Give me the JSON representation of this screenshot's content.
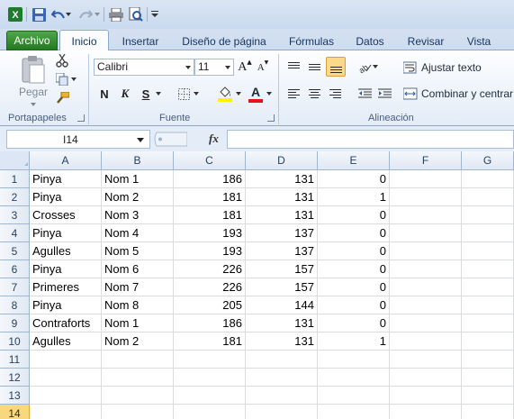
{
  "title_bar": {
    "excel_icon": "excel-x-icon",
    "save_icon": "save-icon",
    "undo_icon": "undo-icon",
    "redo_icon": "redo-icon",
    "print_icon": "print-icon",
    "preview_icon": "print-preview-icon"
  },
  "ribbon_tabs": [
    "Archivo",
    "Inicio",
    "Insertar",
    "Diseño de página",
    "Fórmulas",
    "Datos",
    "Revisar",
    "Vista"
  ],
  "ribbon": {
    "clipboard": {
      "paste_label": "Pegar",
      "group_label": "Portapapeles"
    },
    "font": {
      "font_name": "Calibri",
      "font_size": "11",
      "bold": "N",
      "italic": "K",
      "underline": "S",
      "grow": "A",
      "shrink": "A",
      "font_color": "A",
      "group_label": "Fuente"
    },
    "alignment": {
      "wrap_text": "Ajustar texto",
      "merge_center": "Combinar y centrar",
      "group_label": "Alineación"
    }
  },
  "formula_bar": {
    "name_box": "I14",
    "fx_label": "fx",
    "formula": ""
  },
  "sheet": {
    "columns": [
      "A",
      "B",
      "C",
      "D",
      "E",
      "F",
      "G"
    ],
    "rows": [
      [
        "Pinya",
        "Nom 1",
        "186",
        "131",
        "0",
        "",
        ""
      ],
      [
        "Pinya",
        "Nom 2",
        "181",
        "131",
        "1",
        "",
        ""
      ],
      [
        "Crosses",
        "Nom 3",
        "181",
        "131",
        "0",
        "",
        ""
      ],
      [
        "Pinya",
        "Nom 4",
        "193",
        "137",
        "0",
        "",
        ""
      ],
      [
        "Agulles",
        "Nom 5",
        "193",
        "137",
        "0",
        "",
        ""
      ],
      [
        "Pinya",
        "Nom 6",
        "226",
        "157",
        "0",
        "",
        ""
      ],
      [
        "Primeres",
        "Nom 7",
        "226",
        "157",
        "0",
        "",
        ""
      ],
      [
        "Pinya",
        "Nom 8",
        "205",
        "144",
        "0",
        "",
        ""
      ],
      [
        "Contraforts",
        "Nom 1",
        "186",
        "131",
        "0",
        "",
        ""
      ],
      [
        "Agulles",
        "Nom 2",
        "181",
        "131",
        "1",
        "",
        ""
      ],
      [
        "",
        "",
        "",
        "",
        "",
        "",
        ""
      ],
      [
        "",
        "",
        "",
        "",
        "",
        "",
        ""
      ],
      [
        "",
        "",
        "",
        "",
        "",
        "",
        ""
      ],
      [
        "",
        "",
        "",
        "",
        "",
        "",
        ""
      ]
    ],
    "row_numbers": [
      "1",
      "2",
      "3",
      "4",
      "5",
      "6",
      "7",
      "8",
      "9",
      "10",
      "11",
      "12",
      "13",
      "14"
    ],
    "selected_row": "14"
  }
}
